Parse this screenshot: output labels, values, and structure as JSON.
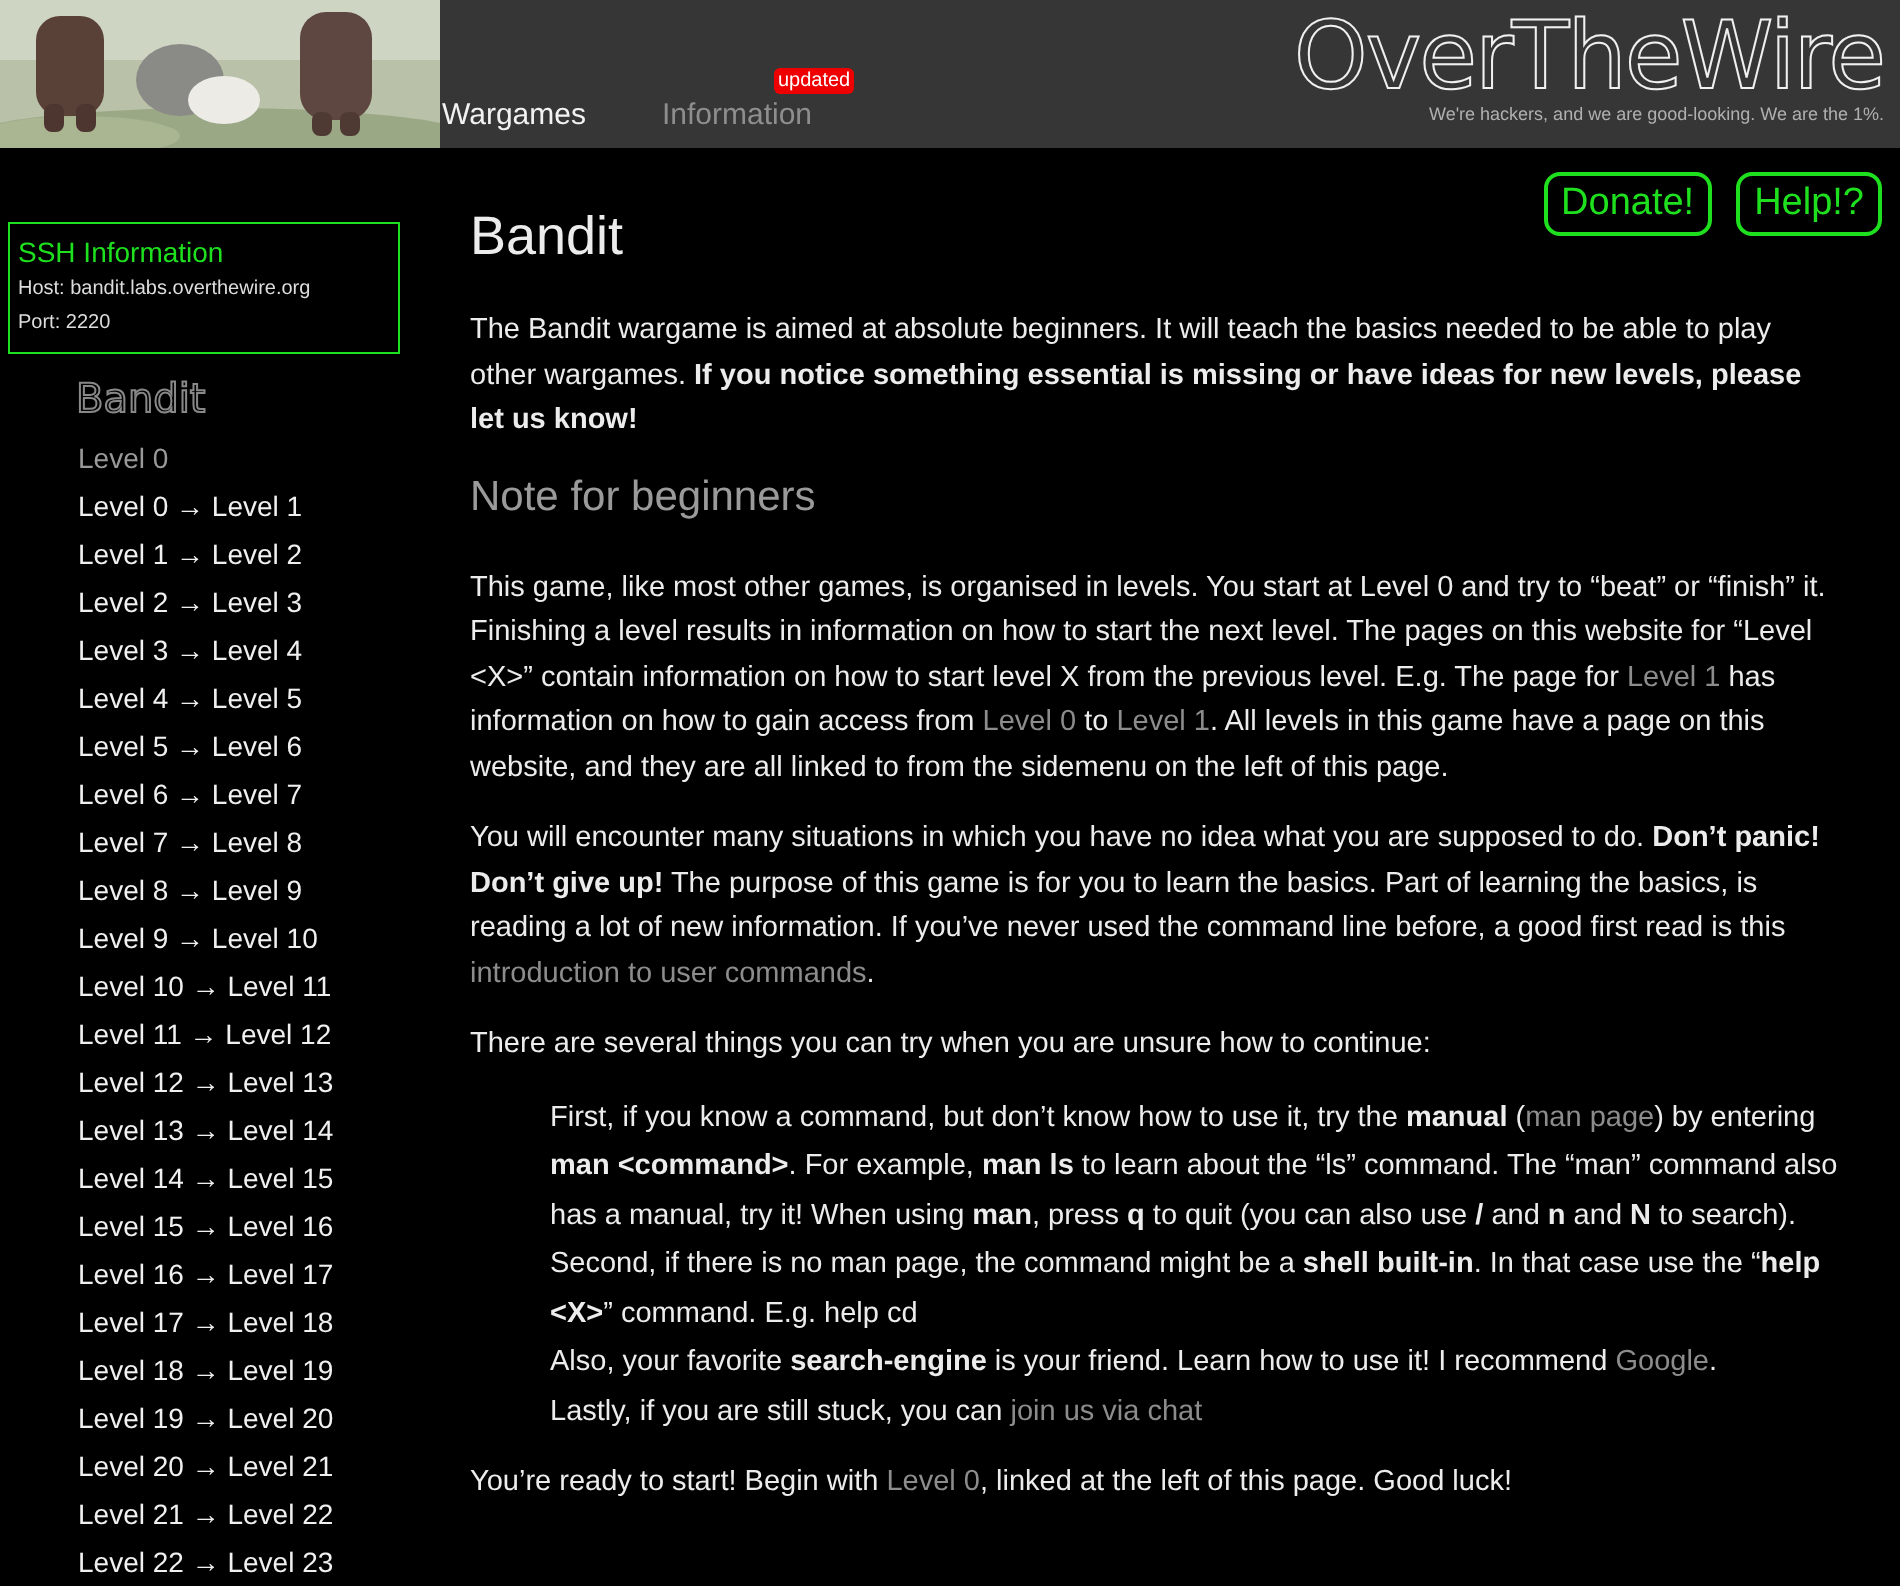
{
  "header": {
    "nav": [
      {
        "label": "Wargames",
        "selected": true
      },
      {
        "label": "Information",
        "selected": false,
        "badge": "updated"
      }
    ],
    "logo": "OverTheWire",
    "tagline": "We're hackers, and we are good-looking. We are the 1%."
  },
  "actions": [
    "Donate!",
    "Help!?"
  ],
  "ssh_info": {
    "title": "SSH Information",
    "lines": [
      "Host: bandit.labs.overthewire.org",
      "Port: 2220"
    ]
  },
  "sidebar": {
    "title": "Bandit",
    "items": [
      {
        "label": "Level 0",
        "visited": true
      },
      {
        "label": "Level 0 → Level 1",
        "visited": false
      },
      {
        "label": "Level 1 → Level 2",
        "visited": false
      },
      {
        "label": "Level 2 → Level 3",
        "visited": false
      },
      {
        "label": "Level 3 → Level 4",
        "visited": false
      },
      {
        "label": "Level 4 → Level 5",
        "visited": false
      },
      {
        "label": "Level 5 → Level 6",
        "visited": false
      },
      {
        "label": "Level 6 → Level 7",
        "visited": false
      },
      {
        "label": "Level 7 → Level 8",
        "visited": false
      },
      {
        "label": "Level 8 → Level 9",
        "visited": false
      },
      {
        "label": "Level 9 → Level 10",
        "visited": false
      },
      {
        "label": "Level 10 → Level 11",
        "visited": false
      },
      {
        "label": "Level 11 → Level 12",
        "visited": false
      },
      {
        "label": "Level 12 → Level 13",
        "visited": false
      },
      {
        "label": "Level 13 → Level 14",
        "visited": false
      },
      {
        "label": "Level 14 → Level 15",
        "visited": false
      },
      {
        "label": "Level 15 → Level 16",
        "visited": false
      },
      {
        "label": "Level 16 → Level 17",
        "visited": false
      },
      {
        "label": "Level 17 → Level 18",
        "visited": false
      },
      {
        "label": "Level 18 → Level 19",
        "visited": false
      },
      {
        "label": "Level 19 → Level 20",
        "visited": false
      },
      {
        "label": "Level 20 → Level 21",
        "visited": false
      },
      {
        "label": "Level 21 → Level 22",
        "visited": false
      },
      {
        "label": "Level 22 → Level 23",
        "visited": false
      }
    ]
  },
  "content": {
    "title": "Bandit",
    "blocks": [
      {
        "kind": "paragraph",
        "segments": [
          {
            "kind": "text",
            "text": "The Bandit wargame is aimed at absolute beginners. It will teach the basics needed to be able to play other wargames. "
          },
          {
            "kind": "bold",
            "text": "If you notice something essential is missing or have ideas for new levels, please let us know!"
          }
        ]
      },
      {
        "kind": "heading",
        "text": "Note for beginners"
      },
      {
        "kind": "paragraph",
        "segments": [
          {
            "kind": "text",
            "text": "This game, like most other games, is organised in levels. You start at Level 0 and try to “beat” or “finish” it. Finishing a level results in information on how to start the next level. The pages on this website for “Level <X>” contain information on how to start level X from the previous level. E.g. The page for "
          },
          {
            "kind": "link",
            "text": "Level 1"
          },
          {
            "kind": "text",
            "text": " has information on how to gain access from "
          },
          {
            "kind": "link",
            "text": "Level 0"
          },
          {
            "kind": "text",
            "text": " to "
          },
          {
            "kind": "link",
            "text": "Level 1"
          },
          {
            "kind": "text",
            "text": ". All levels in this game have a page on this website, and they are all linked to from the sidemenu on the left of this page."
          }
        ]
      },
      {
        "kind": "paragraph",
        "segments": [
          {
            "kind": "text",
            "text": "You will encounter many situations in which you have no idea what you are supposed to do. "
          },
          {
            "kind": "bold",
            "text": "Don’t panic! Don’t give up!"
          },
          {
            "kind": "text",
            "text": " The purpose of this game is for you to learn the basics. Part of learning the basics, is reading a lot of new information. If you’ve never used the command line before, a good first read is this "
          },
          {
            "kind": "link",
            "text": "introduction to user commands"
          },
          {
            "kind": "text",
            "text": "."
          }
        ]
      },
      {
        "kind": "paragraph",
        "segments": [
          {
            "kind": "text",
            "text": "There are several things you can try when you are unsure how to continue:"
          }
        ]
      },
      {
        "kind": "indented",
        "lines": [
          {
            "segments": [
              {
                "kind": "text",
                "text": "First, if you know a command, but don’t know how to use it, try the "
              },
              {
                "kind": "bold",
                "text": "manual"
              },
              {
                "kind": "text",
                "text": " ("
              },
              {
                "kind": "link",
                "text": "man page"
              },
              {
                "kind": "text",
                "text": ") by entering "
              },
              {
                "kind": "bold",
                "text": "man <command>"
              },
              {
                "kind": "text",
                "text": ". For example, "
              },
              {
                "kind": "bold",
                "text": "man ls"
              },
              {
                "kind": "text",
                "text": " to learn about the “ls” command. The “man” command also has a manual, try it! When using "
              },
              {
                "kind": "bold",
                "text": "man"
              },
              {
                "kind": "text",
                "text": ", press "
              },
              {
                "kind": "bold",
                "text": "q"
              },
              {
                "kind": "text",
                "text": " to quit (you can also use "
              },
              {
                "kind": "bold",
                "text": "/"
              },
              {
                "kind": "text",
                "text": " and "
              },
              {
                "kind": "bold",
                "text": "n"
              },
              {
                "kind": "text",
                "text": " and "
              },
              {
                "kind": "bold",
                "text": "N"
              },
              {
                "kind": "text",
                "text": " to search)."
              }
            ]
          },
          {
            "segments": [
              {
                "kind": "text",
                "text": "Second, if there is no man page, the command might be a "
              },
              {
                "kind": "bold",
                "text": "shell built-in"
              },
              {
                "kind": "text",
                "text": ". In that case use the “"
              },
              {
                "kind": "bold",
                "text": "help <X>"
              },
              {
                "kind": "text",
                "text": "” command. E.g. help cd"
              }
            ]
          },
          {
            "segments": [
              {
                "kind": "text",
                "text": "Also, your favorite "
              },
              {
                "kind": "bold",
                "text": "search-engine"
              },
              {
                "kind": "text",
                "text": " is your friend. Learn how to use it! I recommend "
              },
              {
                "kind": "link",
                "text": "Google"
              },
              {
                "kind": "text",
                "text": "."
              }
            ]
          },
          {
            "segments": [
              {
                "kind": "text",
                "text": "Lastly, if you are still stuck, you can "
              },
              {
                "kind": "link",
                "text": "join us via chat"
              }
            ]
          }
        ]
      },
      {
        "kind": "paragraph",
        "segments": [
          {
            "kind": "text",
            "text": "You’re ready to start! Begin with "
          },
          {
            "kind": "link",
            "text": "Level 0"
          },
          {
            "kind": "text",
            "text": ", linked at the left of this page. Good luck!"
          }
        ]
      }
    ]
  }
}
